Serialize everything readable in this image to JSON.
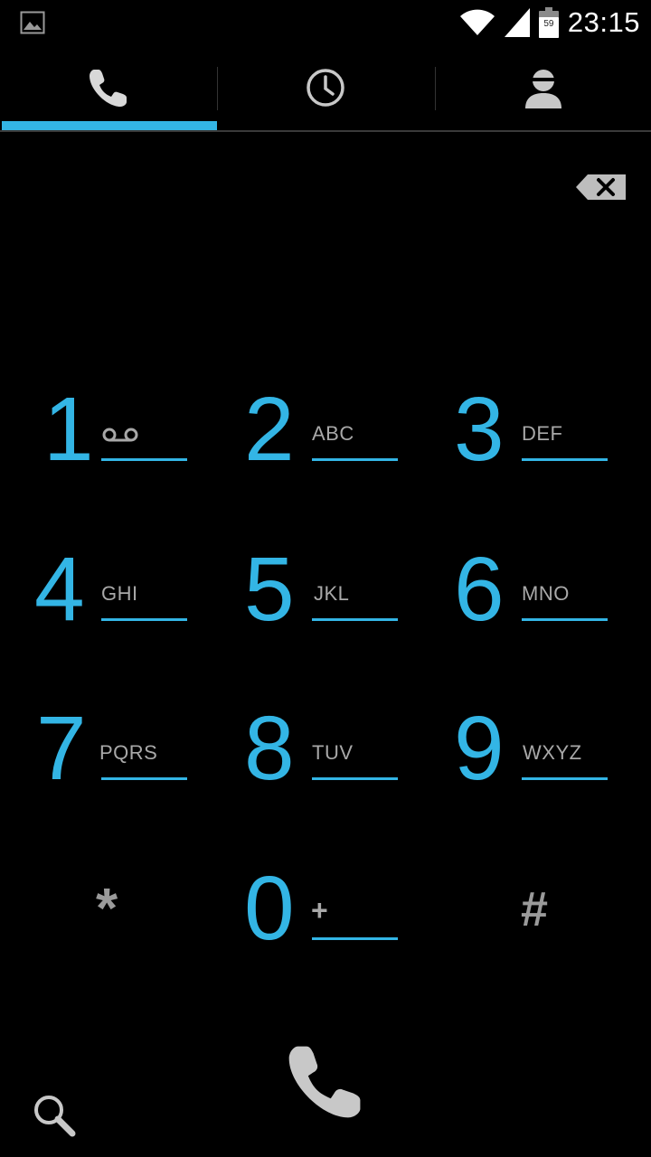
{
  "status_bar": {
    "time": "23:15",
    "battery_level": "59",
    "icons": [
      "gallery-icon",
      "wifi-icon",
      "signal-icon",
      "battery-icon"
    ]
  },
  "tabs": [
    {
      "id": "dialer",
      "icon": "phone-icon",
      "selected": true
    },
    {
      "id": "call-log",
      "icon": "clock-icon",
      "selected": false
    },
    {
      "id": "contacts",
      "icon": "person-icon",
      "selected": false
    }
  ],
  "dialpad": {
    "keys": [
      {
        "digit": "1",
        "letters": "",
        "sub_icon": "voicemail-icon"
      },
      {
        "digit": "2",
        "letters": "ABC"
      },
      {
        "digit": "3",
        "letters": "DEF"
      },
      {
        "digit": "4",
        "letters": "GHI"
      },
      {
        "digit": "5",
        "letters": "JKL"
      },
      {
        "digit": "6",
        "letters": "MNO"
      },
      {
        "digit": "7",
        "letters": "PQRS"
      },
      {
        "digit": "8",
        "letters": "TUV"
      },
      {
        "digit": "9",
        "letters": "WXYZ"
      },
      {
        "digit": "*",
        "letters": ""
      },
      {
        "digit": "0",
        "letters": "+"
      },
      {
        "digit": "#",
        "letters": ""
      }
    ]
  },
  "colors": {
    "accent": "#33b5e5",
    "letters": "#a8a8a8",
    "icon_gray": "#c8c8c8",
    "background": "#000000"
  },
  "bottom_bar": {
    "search_icon": "search-icon",
    "call_icon": "phone-icon"
  }
}
